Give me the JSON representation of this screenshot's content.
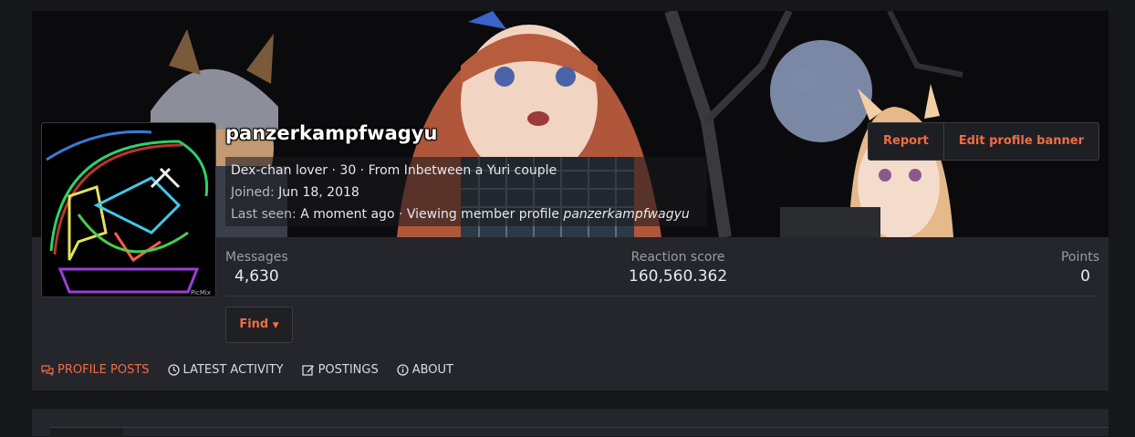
{
  "profile": {
    "username": "panzerkampfwagyu",
    "blurb_line": "Dex-chan lover · 30 · From Inbetween a Yuri couple",
    "joined_label": "Joined:",
    "joined_value": "Jun 18, 2018",
    "last_seen_label": "Last seen:",
    "last_seen_value": "A moment ago · Viewing member profile",
    "last_seen_target": "panzerkampfwagyu",
    "avatar_watermark": "PicMix"
  },
  "actions": {
    "report": "Report",
    "edit_banner": "Edit profile banner",
    "find": "Find"
  },
  "stats": {
    "messages_label": "Messages",
    "messages_value": "4,630",
    "reaction_label": "Reaction score",
    "reaction_value": "160,560.362",
    "points_label": "Points",
    "points_value": "0"
  },
  "tabs": [
    {
      "label": "PROFILE POSTS",
      "icon": "comments-icon",
      "active": true
    },
    {
      "label": "LATEST ACTIVITY",
      "icon": "clock-icon",
      "active": false
    },
    {
      "label": "POSTINGS",
      "icon": "edit-icon",
      "active": false
    },
    {
      "label": "ABOUT",
      "icon": "info-icon",
      "active": false
    }
  ],
  "colors": {
    "accent": "#ef6d46",
    "card_bg": "#25262b",
    "page_bg": "#16171b"
  }
}
